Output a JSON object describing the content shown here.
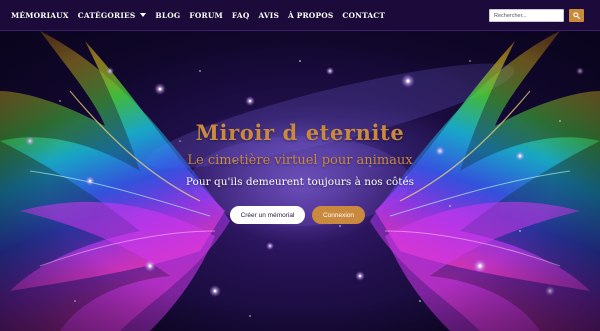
{
  "nav": {
    "items": [
      {
        "label": "MÉMORIAUX"
      },
      {
        "label": "CATÉGORIES",
        "has_dropdown": true
      },
      {
        "label": "BLOG"
      },
      {
        "label": "FORUM"
      },
      {
        "label": "FAQ"
      },
      {
        "label": "AVIS"
      },
      {
        "label": "À PROPOS"
      },
      {
        "label": "CONTACT"
      }
    ],
    "search": {
      "placeholder": "Rechercher...",
      "button_icon": "search-icon"
    }
  },
  "hero": {
    "title": "Miroir d  eternite",
    "subtitle": "Le cimetière virtuel pour animaux",
    "tagline": "Pour qu'ils demeurent toujours à nos côtés",
    "buttons": {
      "create_label": "Créer un mémorial",
      "login_label": "Connexion"
    }
  },
  "colors": {
    "accent": "#c9893f",
    "nav_background": "#1b0a3a",
    "hero_background": "#22104d"
  }
}
